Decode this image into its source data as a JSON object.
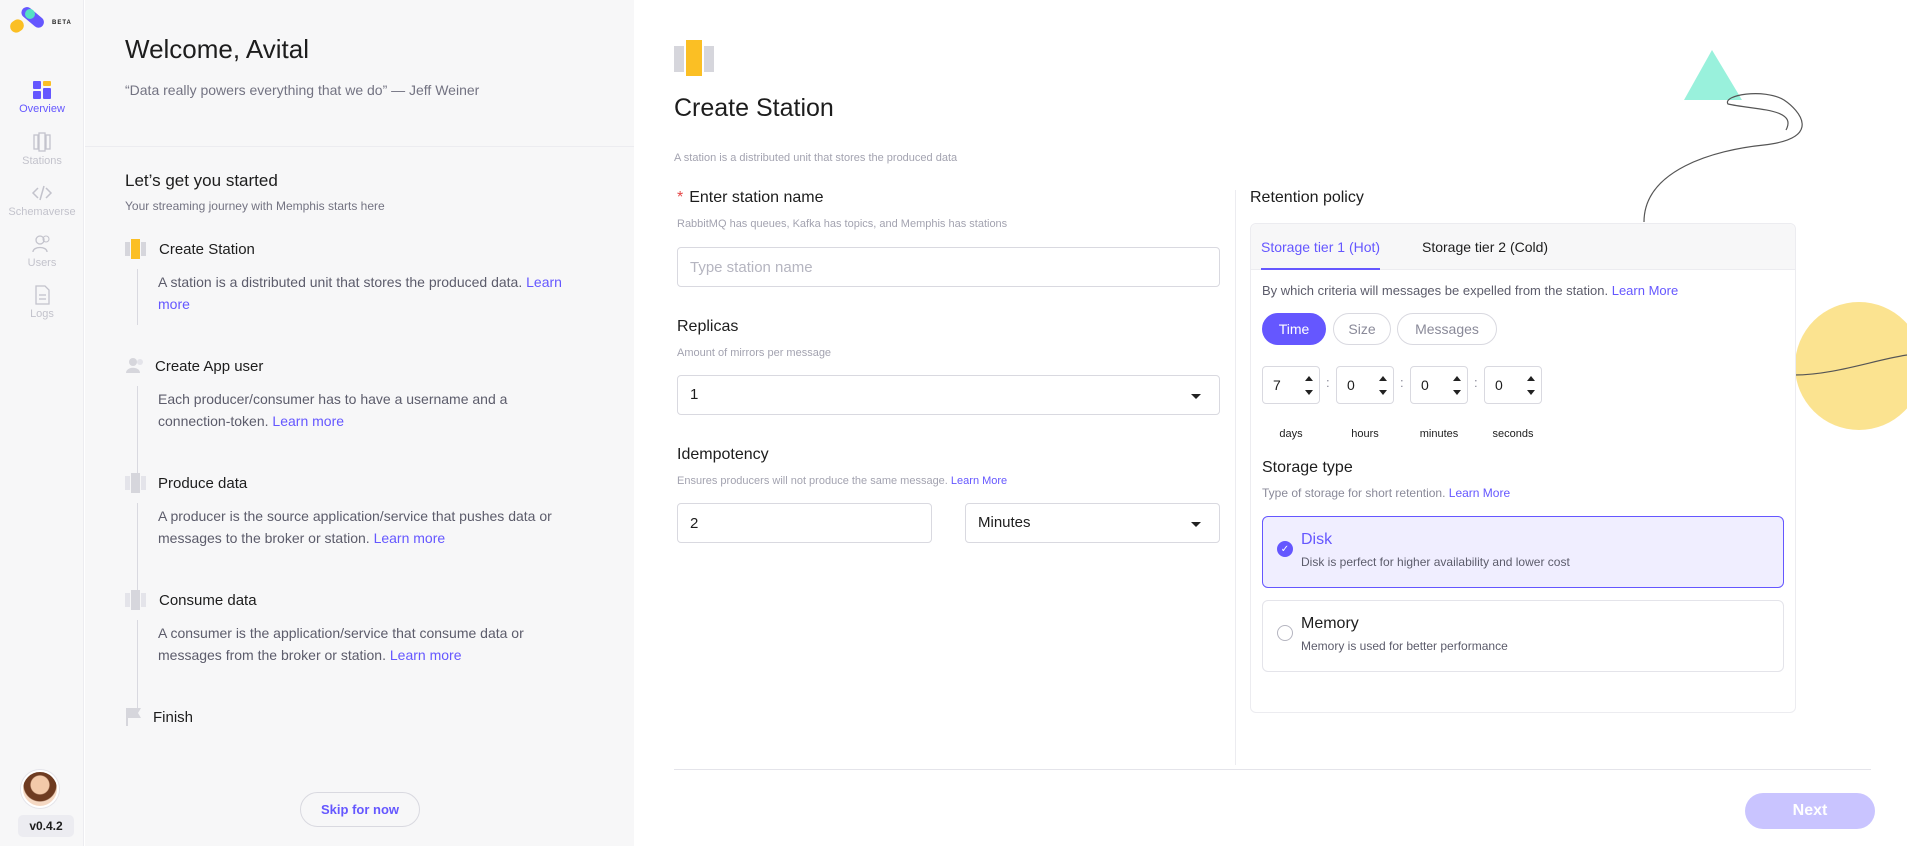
{
  "app": {
    "beta": "BETA",
    "version": "v0.4.2"
  },
  "nav": {
    "items": [
      {
        "label": "Overview",
        "icon": "overview-icon",
        "active": true
      },
      {
        "label": "Stations",
        "icon": "stations-icon",
        "active": false
      },
      {
        "label": "Schemaverse",
        "icon": "code-icon",
        "active": false
      },
      {
        "label": "Users",
        "icon": "users-icon",
        "active": false
      },
      {
        "label": "Logs",
        "icon": "logs-icon",
        "active": false
      }
    ]
  },
  "onboarding": {
    "welcome": "Welcome, Avital",
    "quote": "“Data really powers everything that we do” — Jeff Weiner",
    "start_title": "Let’s get you started",
    "start_sub": "Your streaming journey with Memphis starts here",
    "steps": [
      {
        "title": "Create Station",
        "desc": "A station is a distributed unit that stores the produced data.",
        "link": "Learn more"
      },
      {
        "title": "Create App user",
        "desc": "Each producer/consumer has to have a username and a connection-token.",
        "link": "Learn more"
      },
      {
        "title": "Produce data",
        "desc": "A producer is the source application/service that pushes data or messages to the broker or station.",
        "link": "Learn more"
      },
      {
        "title": "Consume data",
        "desc": "A consumer is the application/service that consume data or messages from the broker or station.",
        "link": "Learn more"
      },
      {
        "title": "Finish"
      }
    ],
    "skip": "Skip for now"
  },
  "main": {
    "title": "Create Station",
    "subtitle": "A station is a distributed unit that stores the produced data",
    "station_name": {
      "required_mark": "*",
      "label": "Enter station name",
      "hint": "RabbitMQ has queues, Kafka has topics, and Memphis has stations",
      "placeholder": "Type station name",
      "value": ""
    },
    "replicas": {
      "label": "Replicas",
      "hint": "Amount of mirrors per message",
      "value": "1"
    },
    "idempotency": {
      "label": "Idempotency",
      "hint": "Ensures producers will not produce the same message.",
      "link": "Learn More",
      "value": "2",
      "unit": "Minutes"
    },
    "next": "Next"
  },
  "retention": {
    "label": "Retention policy",
    "tabs": [
      "Storage tier 1 (Hot)",
      "Storage tier 2 (Cold)"
    ],
    "active_tab": 0,
    "question": "By which criteria will messages be expelled from the station.",
    "question_link": "Learn More",
    "criteria": [
      "Time",
      "Size",
      "Messages"
    ],
    "selected_criteria": "Time",
    "time": [
      {
        "value": "7",
        "unit": "days"
      },
      {
        "value": "0",
        "unit": "hours"
      },
      {
        "value": "0",
        "unit": "minutes"
      },
      {
        "value": "0",
        "unit": "seconds"
      }
    ],
    "storage_type": {
      "label": "Storage type",
      "hint": "Type of storage for short retention.",
      "link": "Learn More",
      "options": [
        {
          "title": "Disk",
          "desc": "Disk is perfect for higher availability and lower cost",
          "selected": true
        },
        {
          "title": "Memory",
          "desc": "Memory is used for better performance",
          "selected": false
        }
      ]
    }
  },
  "colors": {
    "accent": "#6557ff",
    "highlight": "#fbbf24",
    "mint": "#8ef0d8",
    "sun": "#fbe28a"
  }
}
